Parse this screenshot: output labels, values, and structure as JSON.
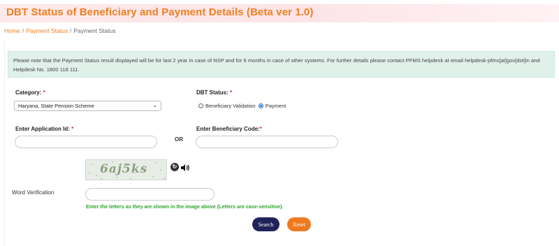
{
  "header": {
    "title": "DBT Status of Beneficiary and Payment Details (Beta ver 1.0)"
  },
  "breadcrumb": {
    "home": "Home",
    "payment_status": "Payment Status",
    "current": "Payment Status",
    "separator": "/"
  },
  "notice": {
    "text": "Please note that the Payment Status result displayed will be for last 2 year in case of NSP and for 6 months in case of other systems. For further details please contact PFMS helpdesk at email helpdesk-pfms[at]gov[dot]in and Helpdesk No. 1800 118 111."
  },
  "form": {
    "category_label": "Category:",
    "category_value": "Haryana, State Pension Scheme",
    "dbt_status_label": "DBT Status:",
    "dbt_options": [
      "Beneficiary Validation",
      "Payment"
    ],
    "dbt_selected": "Payment",
    "application_id_label": "Enter Application Id:",
    "application_id_value": "",
    "or_label": "OR",
    "beneficiary_code_label": "Enter Beneficiary Code:",
    "beneficiary_code_value": "",
    "captcha_text": "6aj5ks",
    "word_verification_label": "Word Verification",
    "word_verification_value": "",
    "hint": "Enter the letters as they are shown in the image above (Letters are case-sensitive).",
    "required_mark": "*"
  },
  "buttons": {
    "search": "Search",
    "reset": "Reset"
  },
  "icons": {
    "refresh": "refresh-icon",
    "audio": "speaker-icon",
    "dropdown": "chevron-down-icon"
  },
  "colors": {
    "accent_orange": "#f07f1f",
    "notice_bg": "#e0f1ea",
    "hint_green": "#2fa52f",
    "search_button": "#20235a",
    "reset_button": "#f07a22"
  }
}
